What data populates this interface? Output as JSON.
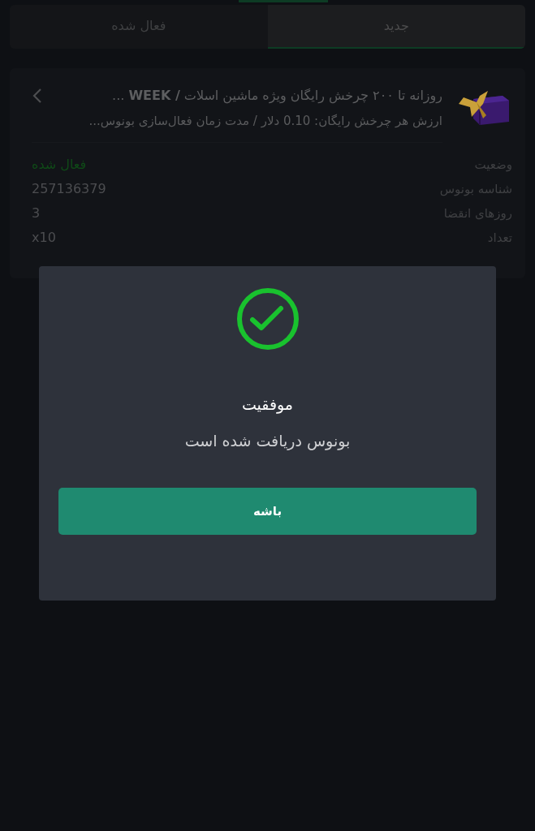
{
  "tabs": [
    {
      "label": "جدید",
      "selected": true
    },
    {
      "label": "فعال شده",
      "selected": false
    }
  ],
  "bonus_card": {
    "title": "روزانه تا ۲۰۰ چرخش رایگان ویژه ماشین اسلات **/ WEEK** ...",
    "description": "ارزش هر چرخش رایگان: 0.10 دلار / مدت زمان فعال‌سازی بونوس...",
    "details": [
      {
        "label": "وضعیت",
        "value": "فعال شده",
        "kind": "status"
      },
      {
        "label": "شناسه بونوس",
        "value": "257136379",
        "kind": "text"
      },
      {
        "label": "روزهای انقضا",
        "value": "3",
        "kind": "text"
      },
      {
        "label": "تعداد",
        "value": "x10",
        "kind": "text"
      }
    ]
  },
  "dialog": {
    "title": "موفقیت",
    "message": "بونوس دریافت شده است",
    "button": "باشه"
  }
}
